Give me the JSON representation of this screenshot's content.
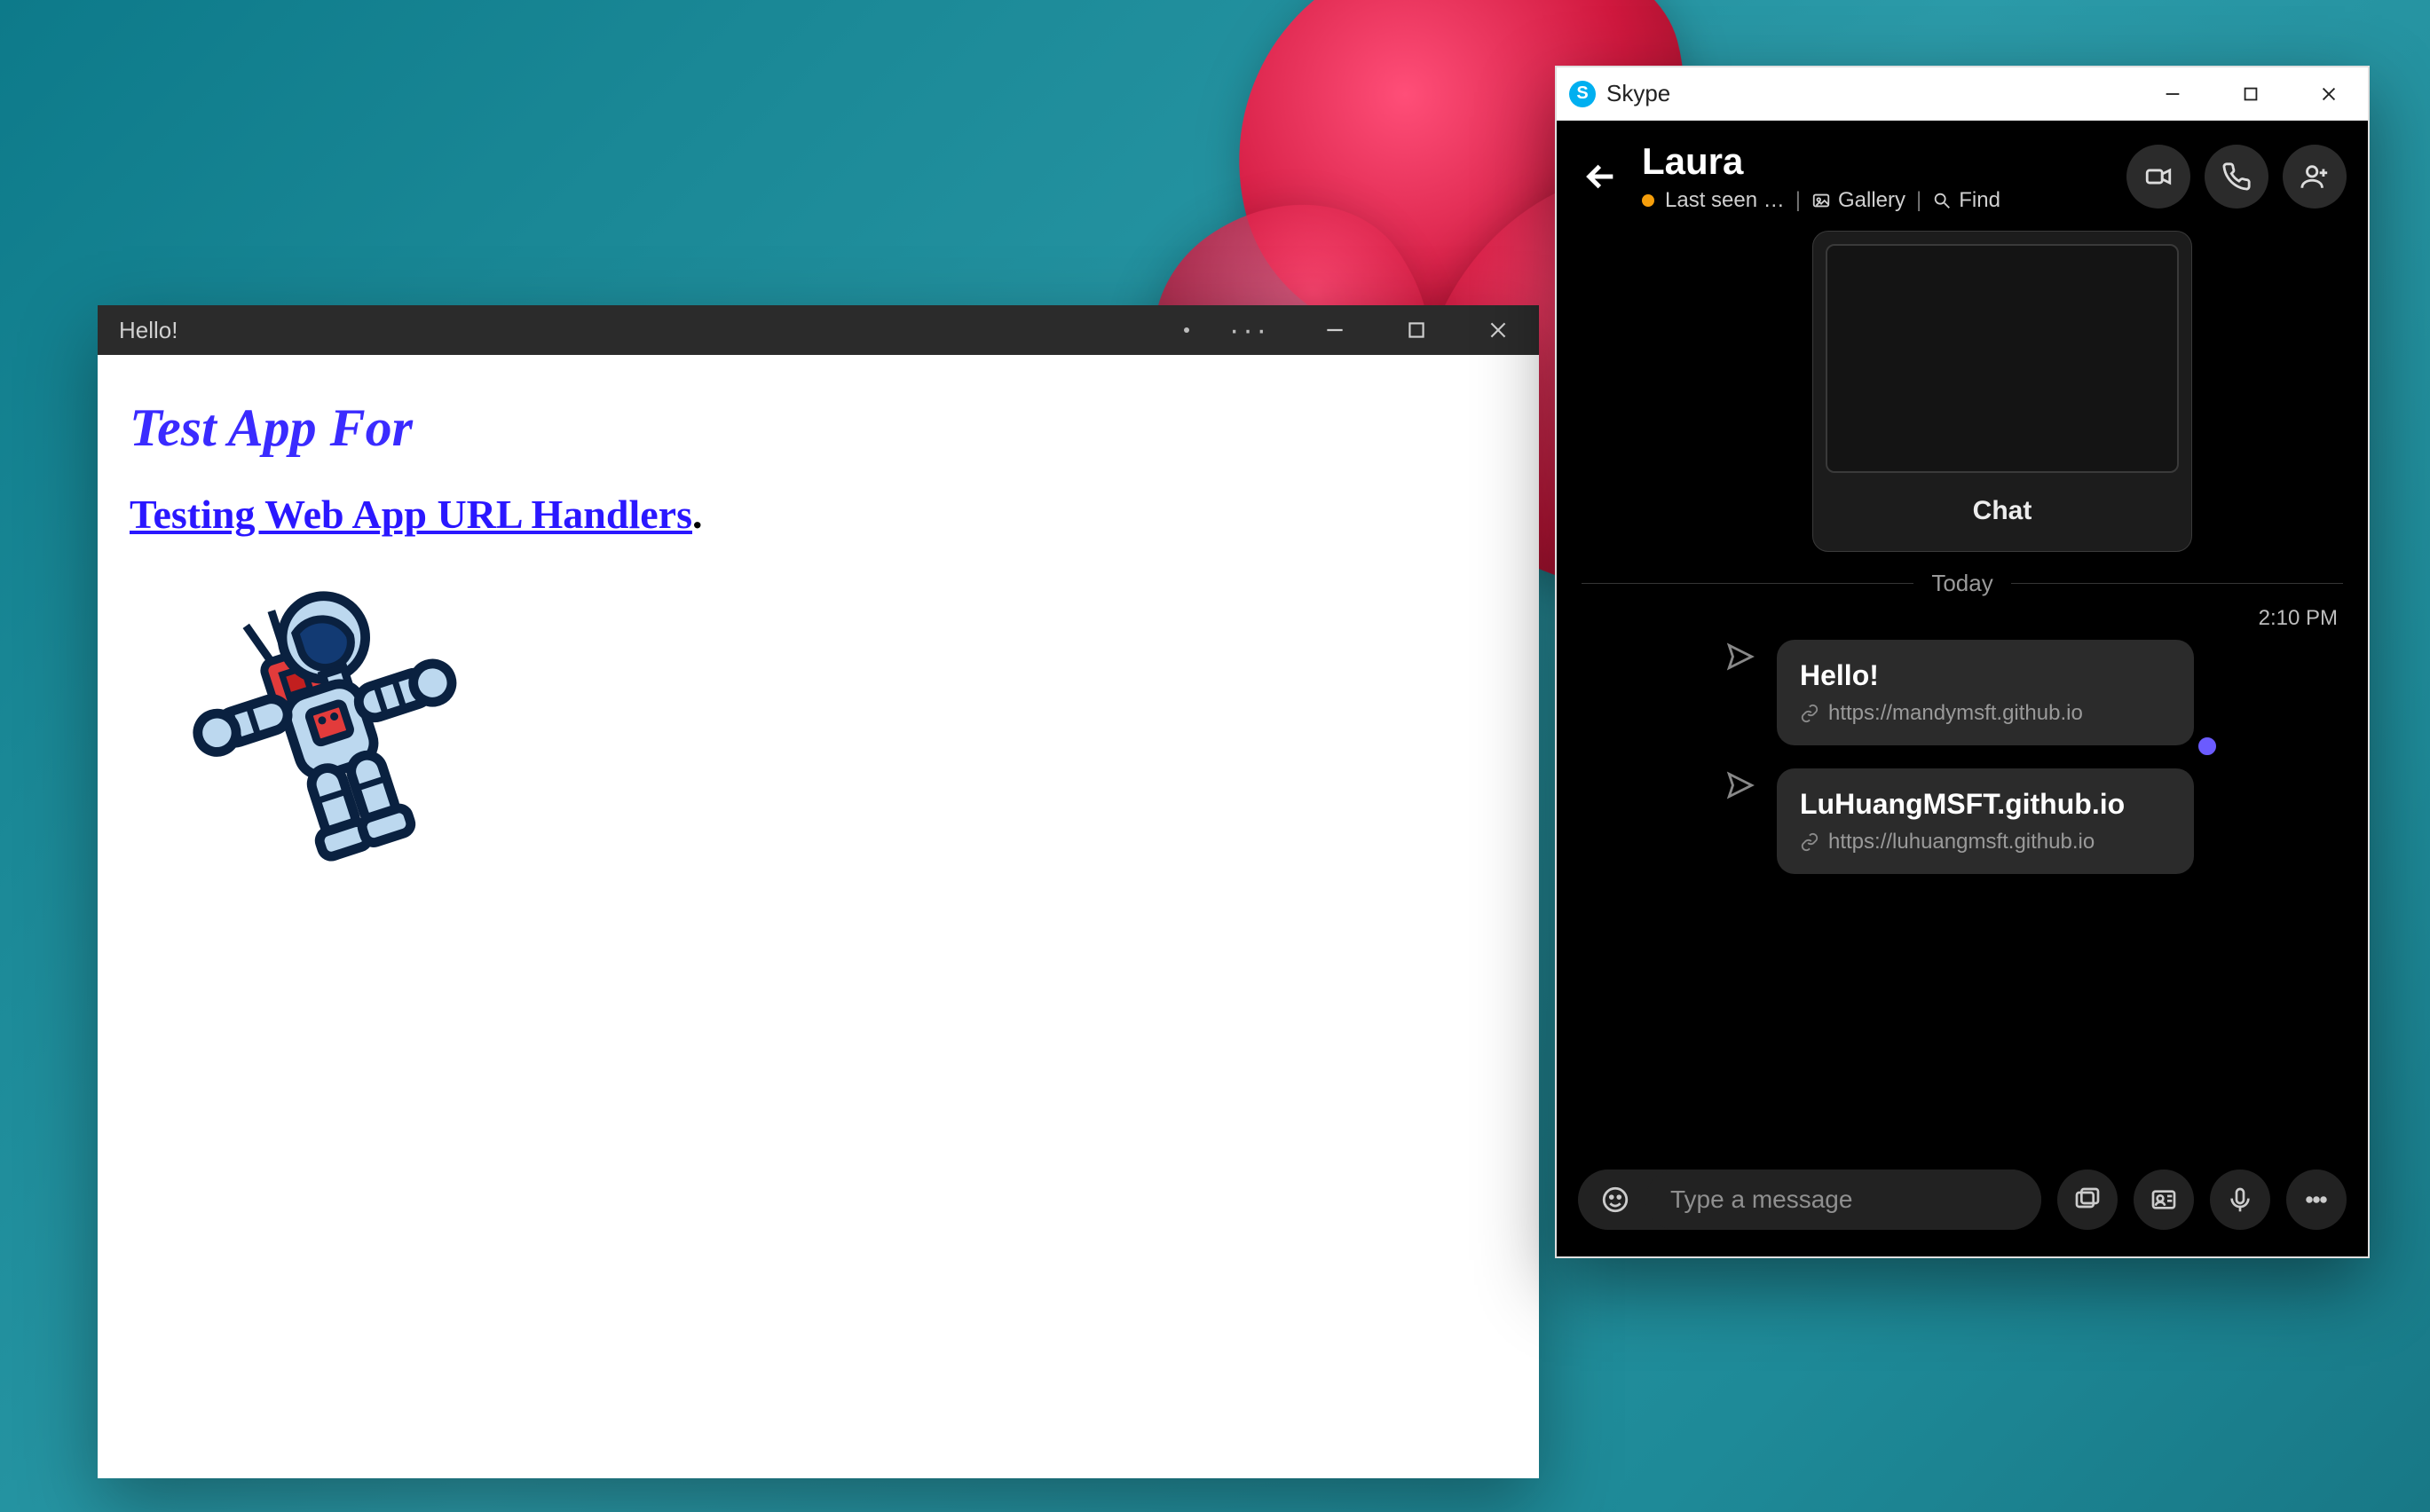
{
  "pwa": {
    "title": "Hello!",
    "heading": "Test App For",
    "link_text": "Testing Web App URL Handlers",
    "period": "."
  },
  "skype": {
    "app_name": "Skype",
    "contact": {
      "name": "Laura",
      "last_seen": "Last seen …",
      "gallery": "Gallery",
      "find": "Find"
    },
    "link_card": {
      "caption": "Chat"
    },
    "day_separator": "Today",
    "messages": [
      {
        "time": "2:10 PM",
        "title": "Hello!",
        "url": "https://mandymsft.github.io"
      },
      {
        "title": "LuHuangMSFT.github.io",
        "url": "https://luhuangmsft.github.io"
      }
    ],
    "composer": {
      "placeholder": "Type a message"
    }
  }
}
